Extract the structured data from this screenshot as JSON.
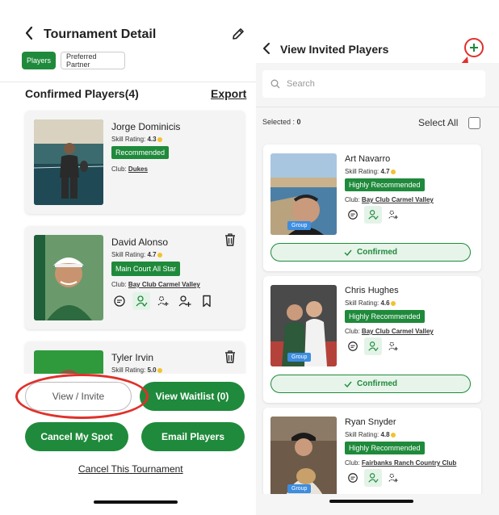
{
  "left": {
    "header": {
      "back": "‹",
      "title": "Tournament Detail"
    },
    "tabs": [
      {
        "label": "Players",
        "active": true
      },
      {
        "label": "Preferred Partner",
        "active": false
      }
    ],
    "section_title": "Confirmed Players(4)",
    "export_label": "Export",
    "skill_label": "Skill Rating:",
    "club_label": "Club:",
    "players": [
      {
        "name": "Jorge Dominicis",
        "rating": "4.3",
        "badge": "Recommended",
        "club": "Dukes"
      },
      {
        "name": "David Alonso",
        "rating": "4.7",
        "badge": "Main Court All Star",
        "club": "Bay Club Carmel Valley"
      },
      {
        "name": "Tyler Irvin",
        "rating": "5.0"
      }
    ],
    "buttons": {
      "view_invite": "View / Invite",
      "view_waitlist": "View Waitlist (0)",
      "cancel_spot": "Cancel My Spot",
      "email_players": "Email Players",
      "cancel_tournament": "Cancel This Tournament"
    }
  },
  "right": {
    "header": {
      "back": "‹",
      "title": "View Invited Players"
    },
    "search_placeholder": "Search",
    "selected_label": "Selected :",
    "selected_count": "0",
    "select_all": "Select All",
    "skill_label": "Skill Rating:",
    "club_label": "Club:",
    "group_tag": "Group",
    "confirmed_label": "Confirmed",
    "players": [
      {
        "name": "Art Navarro",
        "rating": "4.7",
        "badge": "Highly Recommended",
        "club": "Bay Club Carmel Valley"
      },
      {
        "name": "Chris Hughes",
        "rating": "4.6",
        "badge": "Highly Recommended",
        "club": "Bay Club Carmel Valley"
      },
      {
        "name": "Ryan Snyder",
        "rating": "4.8",
        "badge": "Highly Recommended",
        "club": "Fairbanks Ranch Country Club"
      }
    ]
  },
  "colors": {
    "brand_green": "#1f8a3b",
    "annotation_red": "#e0302a",
    "group_blue": "#3d8de0",
    "rating_dot": "#f2c230"
  }
}
